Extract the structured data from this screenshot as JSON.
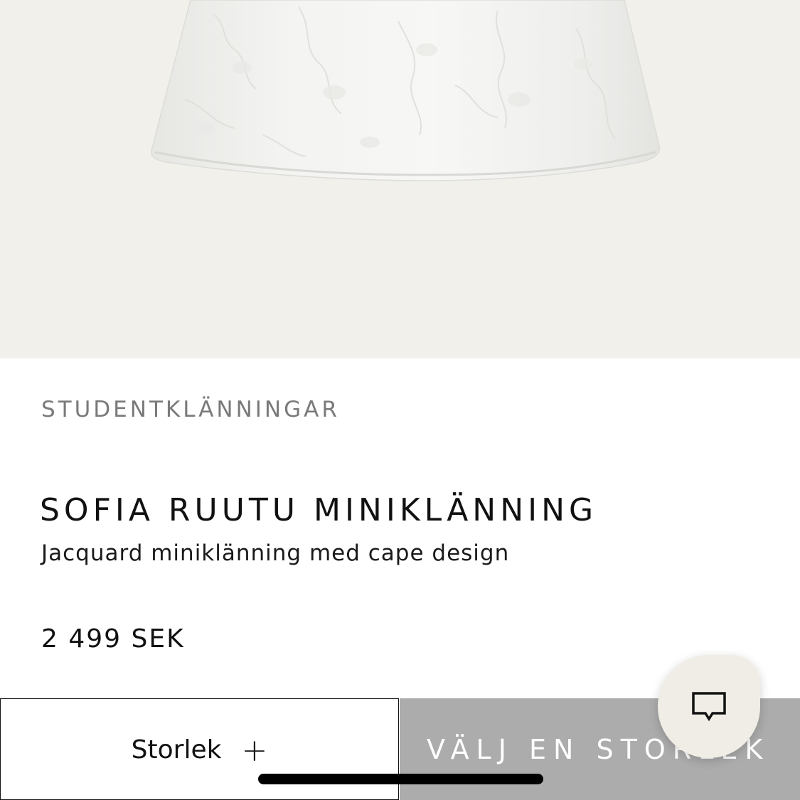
{
  "product_image": {
    "background_color": "#f2f0ea",
    "subject": "white jacquard dress skirt"
  },
  "product": {
    "category": "STUDENTKLÄNNINGAR",
    "title": "SOFIA RUUTU MINIKLÄNNING",
    "subtitle": "Jacquard miniklänning med cape design",
    "price": "2 499 SEK"
  },
  "size_selector": {
    "label": "Storlek",
    "icon": "+"
  },
  "add_to_cart": {
    "label": "VÄLJ EN STORLEK",
    "background_color": "#acacac"
  },
  "chat": {
    "icon": "chat-bubble-icon"
  }
}
